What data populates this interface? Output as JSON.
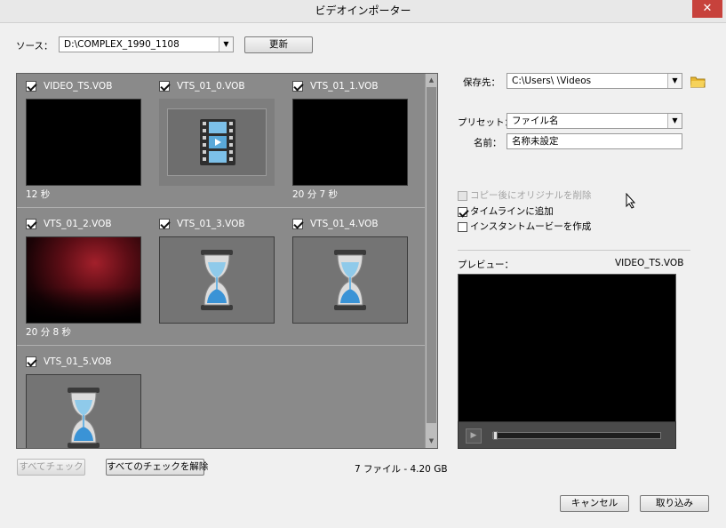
{
  "window": {
    "title": "ビデオインポーター",
    "close": "✕"
  },
  "source": {
    "label": "ソース：",
    "value": "D:\\COMPLEX_1990_1108",
    "refresh_label": "更新"
  },
  "clips": [
    {
      "name": "VIDEO_TS.VOB",
      "checked": true,
      "thumb": "black",
      "duration": "12 秒"
    },
    {
      "name": "VTS_01_0.VOB",
      "checked": true,
      "thumb": "film-icon",
      "duration": ""
    },
    {
      "name": "VTS_01_1.VOB",
      "checked": true,
      "thumb": "black",
      "duration": "20 分 7 秒"
    },
    {
      "name": "VTS_01_2.VOB",
      "checked": true,
      "thumb": "concert",
      "duration": "20 分 8 秒"
    },
    {
      "name": "VTS_01_3.VOB",
      "checked": true,
      "thumb": "hourglass-icon",
      "duration": ""
    },
    {
      "name": "VTS_01_4.VOB",
      "checked": true,
      "thumb": "hourglass-icon",
      "duration": ""
    },
    {
      "name": "VTS_01_5.VOB",
      "checked": true,
      "thumb": "hourglass-icon",
      "duration": ""
    }
  ],
  "footer": {
    "check_all_label": "すべてチェック",
    "uncheck_all_label": "すべてのチェックを解除",
    "summary": "7 ファイル - 4.20 GB",
    "cancel_label": "キャンセル",
    "import_label": "取り込み"
  },
  "save": {
    "label": "保存先：",
    "path": "C:\\Users\\      \\Videos"
  },
  "preset": {
    "label": "プリセット：",
    "value": "ファイル名"
  },
  "name": {
    "label": "名前：",
    "value": "名称未設定"
  },
  "options": {
    "delete_after_copy": {
      "label": "コピー後にオリジナルを削除",
      "checked": false,
      "enabled": false
    },
    "add_to_timeline": {
      "label": "タイムラインに追加",
      "checked": true,
      "enabled": true
    },
    "instant_movie": {
      "label": "インスタントムービーを作成",
      "checked": false,
      "enabled": true
    }
  },
  "preview": {
    "label": "プレビュー：",
    "file": "VIDEO_TS.VOB",
    "play": "▶",
    "position": 0
  }
}
